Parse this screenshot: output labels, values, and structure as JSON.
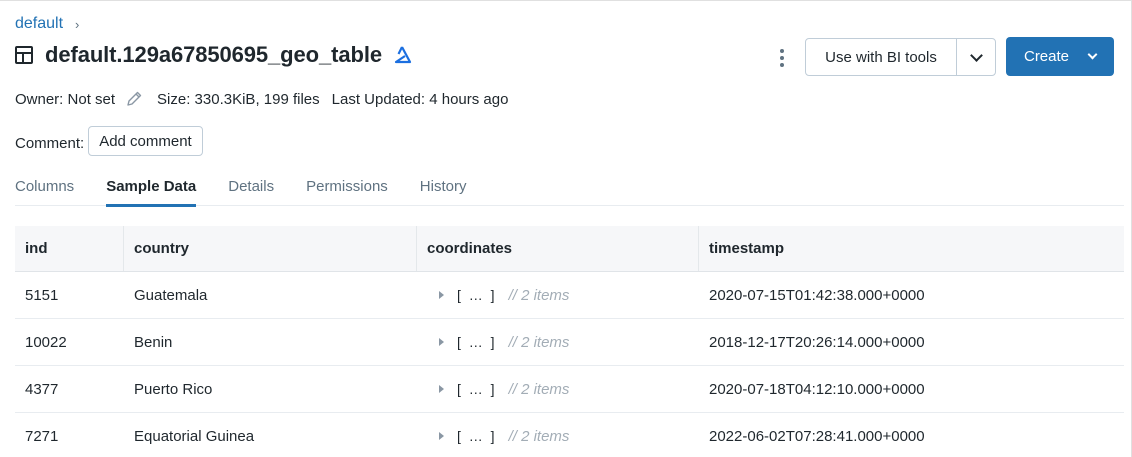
{
  "breadcrumb": {
    "catalog": "default",
    "separator": "›"
  },
  "header": {
    "title": "default.129a67850695_geo_table",
    "bi_label": "Use with BI tools",
    "create_label": "Create"
  },
  "meta": {
    "owner": "Owner: Not set",
    "size": "Size: 330.3KiB, 199 files",
    "updated": "Last Updated: 4 hours ago"
  },
  "comment": {
    "label": "Comment:",
    "button": "Add comment"
  },
  "tabs": [
    {
      "label": "Columns",
      "active": false
    },
    {
      "label": "Sample Data",
      "active": true
    },
    {
      "label": "Details",
      "active": false
    },
    {
      "label": "Permissions",
      "active": false
    },
    {
      "label": "History",
      "active": false
    }
  ],
  "table": {
    "columns": [
      "ind",
      "country",
      "coordinates",
      "timestamp"
    ],
    "rows": [
      {
        "ind": "5151",
        "country": "Guatemala",
        "coord_bracket": "[ … ]",
        "coord_note": "// 2 items",
        "timestamp": "2020-07-15T01:42:38.000+0000"
      },
      {
        "ind": "10022",
        "country": "Benin",
        "coord_bracket": "[ … ]",
        "coord_note": "// 2 items",
        "timestamp": "2018-12-17T20:26:14.000+0000"
      },
      {
        "ind": "4377",
        "country": "Puerto Rico",
        "coord_bracket": "[ … ]",
        "coord_note": "// 2 items",
        "timestamp": "2020-07-18T04:12:10.000+0000"
      },
      {
        "ind": "7271",
        "country": "Equatorial Guinea",
        "coord_bracket": "[ … ]",
        "coord_note": "// 2 items",
        "timestamp": "2022-06-02T07:28:41.000+0000"
      }
    ]
  },
  "colors": {
    "accent": "#2272b4",
    "text": "#1f272d",
    "muted": "#5f7281",
    "delta_icon": "#1b6fe0"
  },
  "icons": [
    "table-icon",
    "delta-icon",
    "pencil-icon",
    "kebab-menu-icon",
    "chevron-down-icon",
    "expand-arrow-icon"
  ]
}
